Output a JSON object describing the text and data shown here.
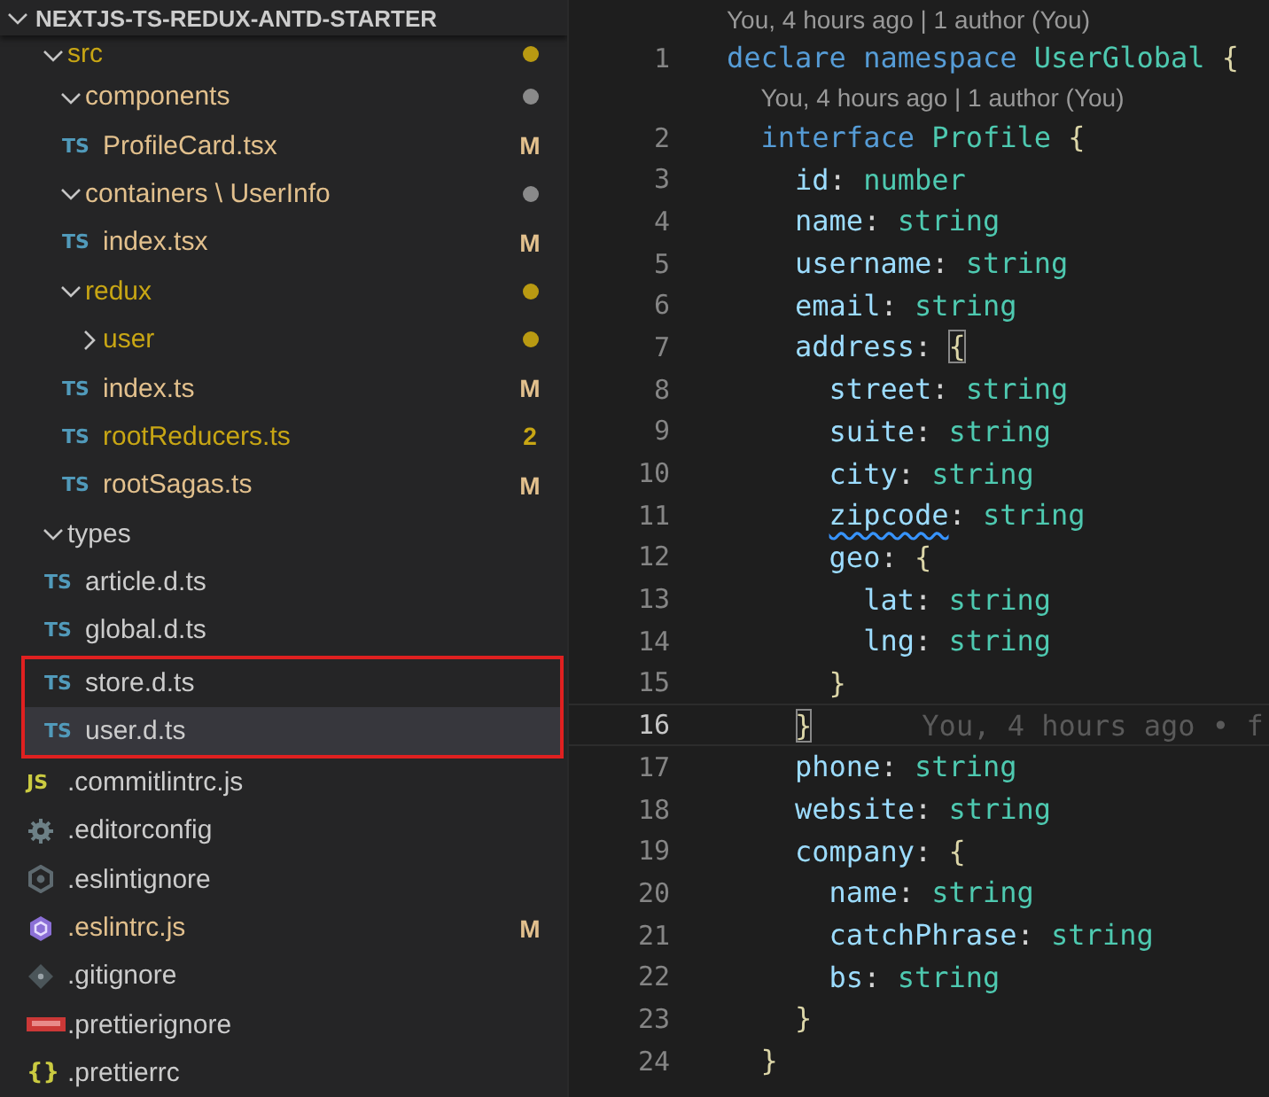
{
  "explorer": {
    "title": "NEXTJS-TS-REDUX-ANTD-STARTER",
    "expanded": true,
    "tree": [
      {
        "name": "src",
        "kind": "folder",
        "expanded": true,
        "problem": true,
        "color": "#b99a12",
        "selected": false,
        "children": [
          {
            "name": "components",
            "kind": "folder",
            "expanded": true,
            "problem": false,
            "modified": true,
            "color": "#8a8a8a",
            "selected": false,
            "children": [
              {
                "name": "ProfileCard.tsx",
                "kind": "ts",
                "icon_text": "TS",
                "problem": false,
                "modified": true,
                "badge": "M",
                "selected": false
              }
            ]
          },
          {
            "name": "containers \\ UserInfo",
            "kind": "folder",
            "expanded": true,
            "problem": false,
            "modified": true,
            "color": "#8a8a8a",
            "selected": false,
            "children": [
              {
                "name": "index.tsx",
                "kind": "ts",
                "icon_text": "TS",
                "problem": false,
                "modified": true,
                "badge": "M",
                "selected": false
              }
            ]
          },
          {
            "name": "redux",
            "kind": "folder",
            "expanded": true,
            "problem": true,
            "color": "#b99a12",
            "selected": false,
            "children": [
              {
                "name": "user",
                "kind": "folder",
                "expanded": false,
                "problem": true,
                "color": "#b99a12",
                "selected": false
              },
              {
                "name": "index.ts",
                "kind": "ts",
                "icon_text": "TS",
                "problem": false,
                "modified": true,
                "badge": "M",
                "selected": false
              },
              {
                "name": "rootReducers.ts",
                "kind": "ts",
                "icon_text": "TS",
                "problem": true,
                "badge": "2",
                "selected": false
              },
              {
                "name": "rootSagas.ts",
                "kind": "ts",
                "icon_text": "TS",
                "problem": false,
                "modified": true,
                "badge": "M",
                "selected": false
              }
            ]
          }
        ]
      },
      {
        "name": "types",
        "kind": "folder",
        "expanded": true,
        "problem": false,
        "modified": false,
        "selected": false,
        "children": [
          {
            "name": "article.d.ts",
            "kind": "ts",
            "icon_text": "TS",
            "problem": false,
            "modified": false,
            "selected": false
          },
          {
            "name": "global.d.ts",
            "kind": "ts",
            "icon_text": "TS",
            "problem": false,
            "modified": false,
            "selected": false
          },
          {
            "name": "store.d.ts",
            "kind": "ts",
            "icon_text": "TS",
            "problem": false,
            "modified": false,
            "selected": false,
            "marked": true
          },
          {
            "name": "user.d.ts",
            "kind": "ts",
            "icon_text": "TS",
            "problem": false,
            "modified": false,
            "selected": true,
            "marked": true
          }
        ]
      },
      {
        "name": ".commitlintrc.js",
        "kind": "js",
        "icon_text": "JS",
        "problem": false,
        "modified": false,
        "selected": false
      },
      {
        "name": ".editorconfig",
        "kind": "gear",
        "problem": false,
        "modified": false,
        "selected": false
      },
      {
        "name": ".eslintignore",
        "kind": "ring",
        "problem": false,
        "modified": false,
        "selected": false
      },
      {
        "name": ".eslintrc.js",
        "kind": "hexagon",
        "problem": false,
        "modified": true,
        "badge": "M",
        "selected": false
      },
      {
        "name": ".gitignore",
        "kind": "diamond",
        "problem": false,
        "modified": false,
        "selected": false
      },
      {
        "name": ".prettierignore",
        "kind": "npm",
        "problem": false,
        "modified": false,
        "selected": false
      },
      {
        "name": ".prettierrc",
        "kind": "braces",
        "icon_text": "{}",
        "problem": false,
        "modified": false,
        "selected": false
      }
    ]
  },
  "editor": {
    "lines": [
      {
        "number": "1",
        "lens": "You, 4 hours ago | 1 author (You)",
        "current": false,
        "tokens": [
          {
            "kind": "keyword",
            "text": "declare"
          },
          {
            "kind": "keyword",
            "text": " namespace"
          },
          {
            "kind": "type",
            "text": " UserGlobal"
          },
          {
            "kind": "bracket",
            "text": " {"
          }
        ]
      },
      {
        "number": "2",
        "lens": "You, 4 hours ago | 1 author (You)",
        "current": false,
        "tokens": [
          {
            "kind": "keyword",
            "text": "  interface"
          },
          {
            "kind": "type",
            "text": " Profile"
          },
          {
            "kind": "bracket",
            "text": " {"
          }
        ]
      },
      {
        "number": "3",
        "current": false,
        "tokens": [
          {
            "kind": "property",
            "text": "    id"
          },
          {
            "kind": "punct",
            "text": ":"
          },
          {
            "kind": "type",
            "text": " number"
          }
        ]
      },
      {
        "number": "4",
        "current": false,
        "tokens": [
          {
            "kind": "property",
            "text": "    name"
          },
          {
            "kind": "punct",
            "text": ":"
          },
          {
            "kind": "type",
            "text": " string"
          }
        ]
      },
      {
        "number": "5",
        "current": false,
        "tokens": [
          {
            "kind": "property",
            "text": "    username"
          },
          {
            "kind": "punct",
            "text": ":"
          },
          {
            "kind": "type",
            "text": " string"
          }
        ]
      },
      {
        "number": "6",
        "current": false,
        "tokens": [
          {
            "kind": "property",
            "text": "    email"
          },
          {
            "kind": "punct",
            "text": ":"
          },
          {
            "kind": "type",
            "text": " string"
          }
        ]
      },
      {
        "number": "7",
        "current": false,
        "tokens": [
          {
            "kind": "property",
            "text": "    address"
          },
          {
            "kind": "punct",
            "text": ": "
          },
          {
            "kind": "bracket",
            "text": "{",
            "matched": true
          }
        ]
      },
      {
        "number": "8",
        "current": false,
        "tokens": [
          {
            "kind": "property",
            "text": "      street"
          },
          {
            "kind": "punct",
            "text": ":"
          },
          {
            "kind": "type",
            "text": " string"
          }
        ]
      },
      {
        "number": "9",
        "current": false,
        "tokens": [
          {
            "kind": "property",
            "text": "      suite"
          },
          {
            "kind": "punct",
            "text": ":"
          },
          {
            "kind": "type",
            "text": " string"
          }
        ]
      },
      {
        "number": "10",
        "current": false,
        "tokens": [
          {
            "kind": "property",
            "text": "      city"
          },
          {
            "kind": "punct",
            "text": ":"
          },
          {
            "kind": "type",
            "text": " string"
          }
        ]
      },
      {
        "number": "11",
        "current": false,
        "tokens": [
          {
            "kind": "property",
            "text": "      zipcode",
            "squiggle": true
          },
          {
            "kind": "punct",
            "text": ":"
          },
          {
            "kind": "type",
            "text": " string"
          }
        ]
      },
      {
        "number": "12",
        "current": false,
        "tokens": [
          {
            "kind": "property",
            "text": "      geo"
          },
          {
            "kind": "punct",
            "text": ": "
          },
          {
            "kind": "bracket",
            "text": "{"
          }
        ]
      },
      {
        "number": "13",
        "current": false,
        "tokens": [
          {
            "kind": "property",
            "text": "        lat"
          },
          {
            "kind": "punct",
            "text": ":"
          },
          {
            "kind": "type",
            "text": " string"
          }
        ]
      },
      {
        "number": "14",
        "current": false,
        "tokens": [
          {
            "kind": "property",
            "text": "        lng"
          },
          {
            "kind": "punct",
            "text": ":"
          },
          {
            "kind": "type",
            "text": " string"
          }
        ]
      },
      {
        "number": "15",
        "current": false,
        "tokens": [
          {
            "kind": "bracket",
            "text": "      }"
          }
        ]
      },
      {
        "number": "16",
        "current": true,
        "blame": "You, 4 hours ago • f",
        "tokens": [
          {
            "kind": "bracket",
            "text": "    }",
            "matched": true
          }
        ]
      },
      {
        "number": "17",
        "current": false,
        "tokens": [
          {
            "kind": "property",
            "text": "    phone"
          },
          {
            "kind": "punct",
            "text": ":"
          },
          {
            "kind": "type",
            "text": " string"
          }
        ]
      },
      {
        "number": "18",
        "current": false,
        "tokens": [
          {
            "kind": "property",
            "text": "    website"
          },
          {
            "kind": "punct",
            "text": ":"
          },
          {
            "kind": "type",
            "text": " string"
          }
        ]
      },
      {
        "number": "19",
        "current": false,
        "tokens": [
          {
            "kind": "property",
            "text": "    company"
          },
          {
            "kind": "punct",
            "text": ": "
          },
          {
            "kind": "bracket",
            "text": "{"
          }
        ]
      },
      {
        "number": "20",
        "current": false,
        "tokens": [
          {
            "kind": "property",
            "text": "      name"
          },
          {
            "kind": "punct",
            "text": ":"
          },
          {
            "kind": "type",
            "text": " string"
          }
        ]
      },
      {
        "number": "21",
        "current": false,
        "tokens": [
          {
            "kind": "property",
            "text": "      catchPhrase"
          },
          {
            "kind": "punct",
            "text": ":"
          },
          {
            "kind": "type",
            "text": " string"
          }
        ]
      },
      {
        "number": "22",
        "current": false,
        "tokens": [
          {
            "kind": "property",
            "text": "      bs"
          },
          {
            "kind": "punct",
            "text": ":"
          },
          {
            "kind": "type",
            "text": " string"
          }
        ]
      },
      {
        "number": "23",
        "current": false,
        "tokens": [
          {
            "kind": "bracket",
            "text": "    }"
          }
        ]
      },
      {
        "number": "24",
        "current": false,
        "tokens": [
          {
            "kind": "bracket",
            "text": "  }"
          }
        ]
      }
    ]
  }
}
